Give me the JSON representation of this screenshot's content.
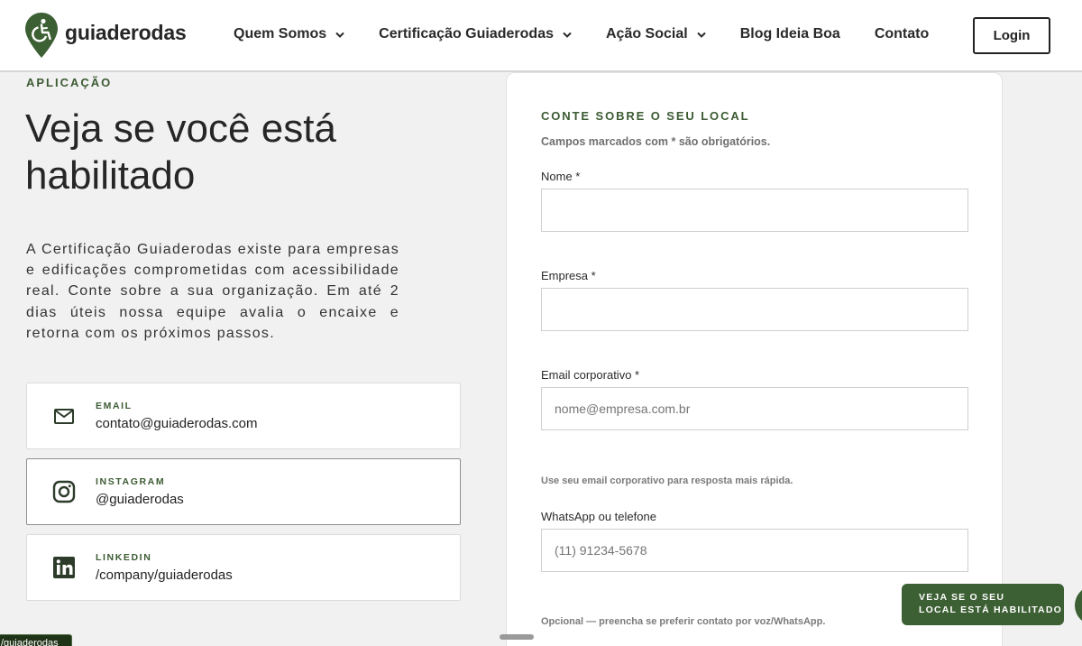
{
  "brand": {
    "name": "guiaderodas",
    "color": "#3c5f33"
  },
  "nav": {
    "items": [
      {
        "label": "Quem Somos",
        "dropdown": true
      },
      {
        "label": "Certificação Guiaderodas",
        "dropdown": true
      },
      {
        "label": "Ação Social",
        "dropdown": true
      },
      {
        "label": "Blog Ideia Boa",
        "dropdown": false
      },
      {
        "label": "Contato",
        "dropdown": false
      }
    ],
    "login_label": "Login"
  },
  "hero": {
    "eyebrow": "APLICAÇÃO",
    "title": "Veja se você está habilitado",
    "lead": "A Certificação Guiaderodas existe para empresas e edificações comprometidas com acessibilidade real. Conte sobre a sua organização. Em até 2 dias úteis nossa equipe avalia o encaixe e retorna com os próximos passos."
  },
  "contacts": [
    {
      "label": "EMAIL",
      "value": "contato@guiaderodas.com",
      "icon": "mail-icon"
    },
    {
      "label": "INSTAGRAM",
      "value": "@guiaderodas",
      "icon": "instagram-icon"
    },
    {
      "label": "LINKEDIN",
      "value": "/company/guiaderodas",
      "icon": "linkedin-icon"
    }
  ],
  "form": {
    "title": "CONTE SOBRE O SEU LOCAL",
    "note": "Campos marcados com * são obrigatórios.",
    "fields": {
      "name": {
        "label": "Nome *",
        "value": ""
      },
      "company": {
        "label": "Empresa *",
        "value": ""
      },
      "email": {
        "label": "Email corporativo *",
        "placeholder": "nome@empresa.com.br",
        "help": "Use seu email corporativo para resposta mais rápida."
      },
      "phone": {
        "label": "WhatsApp ou telefone",
        "placeholder": "(11) 91234-5678",
        "help": "Opcional — preencha se preferir contato por voz/WhatsApp."
      }
    }
  },
  "cta": {
    "line1": "VEJA SE O SEU",
    "line2": "LOCAL ESTÁ HABILITADO"
  },
  "tooltip": "/guiaderodas"
}
